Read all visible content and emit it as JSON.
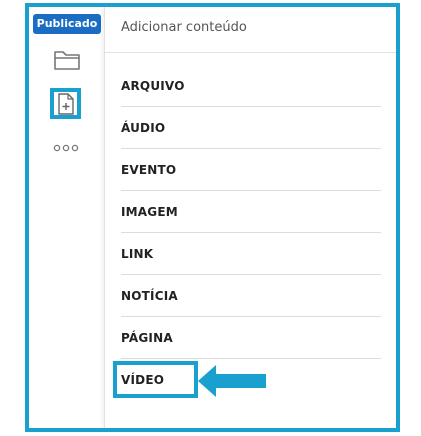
{
  "sidebar": {
    "status_badge": "Publicado",
    "icons": [
      "folder-icon",
      "add-document-icon",
      "more-options-icon"
    ]
  },
  "panel": {
    "title": "Adicionar conteúdo",
    "items": [
      {
        "label": "ARQUIVO"
      },
      {
        "label": "ÁUDIO"
      },
      {
        "label": "EVENTO"
      },
      {
        "label": "IMAGEM"
      },
      {
        "label": "LINK"
      },
      {
        "label": "NOTÍCIA"
      },
      {
        "label": "PÁGINA"
      },
      {
        "label": "VÍDEO"
      }
    ]
  },
  "colors": {
    "highlight": "#1aa0cf",
    "badge": "#1a6dc2"
  }
}
